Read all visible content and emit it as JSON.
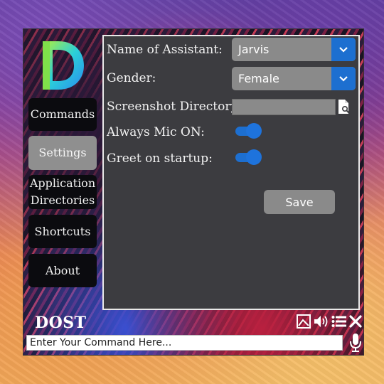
{
  "app": {
    "brand": "DOST"
  },
  "nav": {
    "commands": "Commands",
    "settings": "Settings",
    "application_directories_line1": "Application",
    "application_directories_line2": "Directories",
    "shortcuts": "Shortcuts",
    "about": "About",
    "active": "Settings"
  },
  "settings": {
    "assistant_name_label": "Name of Assistant:",
    "assistant_name_value": "Jarvis",
    "gender_label": "Gender:",
    "gender_value": "Female",
    "screenshot_dir_label": "Screenshot Directory:",
    "screenshot_dir_value": "",
    "always_mic_label": "Always Mic ON:",
    "always_mic_on": true,
    "greet_label": "Greet on startup:",
    "greet_on": true,
    "save_label": "Save"
  },
  "command_bar": {
    "placeholder": "Enter Your Command Here..."
  },
  "icons": {
    "logo": "logo-d-icon",
    "dropdown": "chevron-down-icon",
    "file_browse": "file-search-icon",
    "image": "image-icon",
    "volume": "volume-icon",
    "menu": "list-icon",
    "close": "close-icon",
    "mic": "microphone-icon"
  },
  "colors": {
    "accent": "#1d6fd0",
    "panel": "#3c3c40",
    "control": "#8a8a8a"
  }
}
